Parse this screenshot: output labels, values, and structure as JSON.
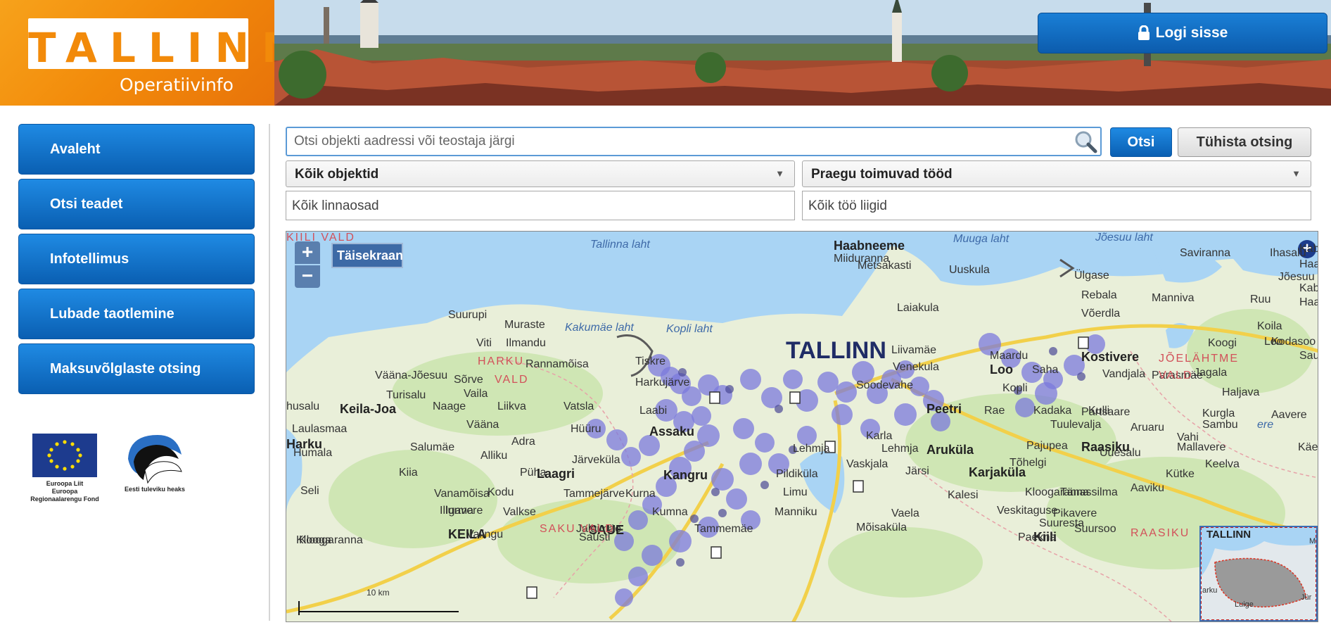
{
  "header": {
    "logo_word": "TALLINN",
    "logo_subtitle": "Operatiivinfo",
    "login_label": "Logi sisse",
    "login_icon": "lock-icon"
  },
  "sidebar": {
    "items": [
      {
        "label": "Avaleht"
      },
      {
        "label": "Otsi teadet"
      },
      {
        "label": "Infotellimus"
      },
      {
        "label": "Lubade taotlemine"
      },
      {
        "label": "Maksuvõlglaste otsing"
      }
    ]
  },
  "logos": {
    "eu_caption": "Euroopa Liit\nEuroopa\nRegionaalarengu Fond",
    "est_caption": "Eesti tuleviku heaks"
  },
  "search": {
    "placeholder": "Otsi objekti aadressi või teostaja järgi",
    "value": "",
    "submit_label": "Otsi",
    "clear_label": "Tühista otsing"
  },
  "filters": {
    "objects_selected": "Kõik objektid",
    "works_selected": "Praegu toimuvad tööd",
    "districts_placeholder": "Kõik linnaosad",
    "work_types_placeholder": "Kõik töö liigid"
  },
  "map": {
    "zoom_in": "+",
    "zoom_out": "−",
    "fullscreen_label": "Täisekraan",
    "scale_label": "10 km",
    "expand_icon": "+",
    "minimap_labels": {
      "city": "TALLINN",
      "a": "arku",
      "b": "Luige",
      "c": "Jür",
      "d": "M"
    },
    "labels": [
      {
        "text": "Tallinna laht",
        "kind": "water"
      },
      {
        "text": "Haabneeme",
        "kind": "town"
      },
      {
        "text": "Miiduranna",
        "kind": "plain"
      },
      {
        "text": "Muuga laht",
        "kind": "water"
      },
      {
        "text": "Jõesuu laht",
        "kind": "water"
      },
      {
        "text": "Saviranna",
        "kind": "plain"
      },
      {
        "text": "Ihasalu",
        "kind": "plain"
      },
      {
        "text": "Kaberneeme",
        "kind": "plain"
      },
      {
        "text": "Haapse",
        "kind": "plain"
      },
      {
        "text": "Metsakasti",
        "kind": "plain"
      },
      {
        "text": "Uuskula",
        "kind": "plain"
      },
      {
        "text": "Ülgase",
        "kind": "plain"
      },
      {
        "text": "Jõesuu",
        "kind": "plain"
      },
      {
        "text": "Kaberla",
        "kind": "plain"
      },
      {
        "text": "Haavakann",
        "kind": "plain"
      },
      {
        "text": "Rebala",
        "kind": "plain"
      },
      {
        "text": "Manniva",
        "kind": "plain"
      },
      {
        "text": "Ruu",
        "kind": "plain"
      },
      {
        "text": "Laiakula",
        "kind": "plain"
      },
      {
        "text": "Võerdla",
        "kind": "plain"
      },
      {
        "text": "Koila",
        "kind": "plain"
      },
      {
        "text": "Loo",
        "kind": "plain"
      },
      {
        "text": "Koogi",
        "kind": "plain"
      },
      {
        "text": "Kodasoo",
        "kind": "plain"
      },
      {
        "text": "Suurupi",
        "kind": "plain"
      },
      {
        "text": "Muraste",
        "kind": "plain"
      },
      {
        "text": "Kakumäe laht",
        "kind": "water"
      },
      {
        "text": "Kopli laht",
        "kind": "water"
      },
      {
        "text": "TALLINN",
        "kind": "city"
      },
      {
        "text": "Liivamäe",
        "kind": "plain"
      },
      {
        "text": "Maardu",
        "kind": "plain"
      },
      {
        "text": "Kostivere",
        "kind": "town"
      },
      {
        "text": "JÕELÄHTME",
        "kind": "region"
      },
      {
        "text": "Saun",
        "kind": "plain"
      },
      {
        "text": "Viti",
        "kind": "plain"
      },
      {
        "text": "Ilmandu",
        "kind": "plain"
      },
      {
        "text": "HARKU",
        "kind": "region"
      },
      {
        "text": "Rannamõisa",
        "kind": "plain"
      },
      {
        "text": "Tiskre",
        "kind": "plain"
      },
      {
        "text": "Venekula",
        "kind": "plain"
      },
      {
        "text": "Loo",
        "kind": "town"
      },
      {
        "text": "Saha",
        "kind": "plain"
      },
      {
        "text": "Vandjala",
        "kind": "plain"
      },
      {
        "text": "Parasmäe",
        "kind": "plain"
      },
      {
        "text": "VALD",
        "kind": "region"
      },
      {
        "text": "Jagala",
        "kind": "plain"
      },
      {
        "text": "Vääna-Jõesuu",
        "kind": "plain"
      },
      {
        "text": "VALD",
        "kind": "region"
      },
      {
        "text": "Sõrve",
        "kind": "plain"
      },
      {
        "text": "Harkujärve",
        "kind": "plain"
      },
      {
        "text": "Soodevahe",
        "kind": "plain"
      },
      {
        "text": "Kopli",
        "kind": "plain"
      },
      {
        "text": "Haljava",
        "kind": "plain"
      },
      {
        "text": "Turisalu",
        "kind": "plain"
      },
      {
        "text": "Vaila",
        "kind": "plain"
      },
      {
        "text": "husalu",
        "kind": "plain"
      },
      {
        "text": "Keila-Joa",
        "kind": "town"
      },
      {
        "text": "Naage",
        "kind": "plain"
      },
      {
        "text": "Liikva",
        "kind": "plain"
      },
      {
        "text": "Vatsla",
        "kind": "plain"
      },
      {
        "text": "Laabi",
        "kind": "plain"
      },
      {
        "text": "Peetri",
        "kind": "town"
      },
      {
        "text": "Rae",
        "kind": "plain"
      },
      {
        "text": "Kadaka",
        "kind": "plain"
      },
      {
        "text": "Kulli",
        "kind": "plain"
      },
      {
        "text": "Partsaare",
        "kind": "plain"
      },
      {
        "text": "Kurgla",
        "kind": "plain"
      },
      {
        "text": "Aavere",
        "kind": "plain"
      },
      {
        "text": "Laulasmaa",
        "kind": "plain"
      },
      {
        "text": "Vääna",
        "kind": "plain"
      },
      {
        "text": "Hüüru",
        "kind": "plain"
      },
      {
        "text": "Tuulevalja",
        "kind": "plain"
      },
      {
        "text": "Aruaru",
        "kind": "plain"
      },
      {
        "text": "Sambu",
        "kind": "plain"
      },
      {
        "text": "ere",
        "kind": "water"
      },
      {
        "text": "Harku",
        "kind": "town"
      },
      {
        "text": "Assaku",
        "kind": "town"
      },
      {
        "text": "Karla",
        "kind": "plain"
      },
      {
        "text": "Pajupea",
        "kind": "plain"
      },
      {
        "text": "Raasiku",
        "kind": "town"
      },
      {
        "text": "Vahi",
        "kind": "plain"
      },
      {
        "text": "Adra",
        "kind": "plain"
      },
      {
        "text": "Salumäe",
        "kind": "plain"
      },
      {
        "text": "Mallavere",
        "kind": "plain"
      },
      {
        "text": "Käesalu",
        "kind": "plain"
      },
      {
        "text": "Humala",
        "kind": "plain"
      },
      {
        "text": "Alliku",
        "kind": "plain"
      },
      {
        "text": "Järveküla",
        "kind": "plain"
      },
      {
        "text": "Lehmja",
        "kind": "plain"
      },
      {
        "text": "Lehmja",
        "kind": "plain"
      },
      {
        "text": "Aruküla",
        "kind": "town"
      },
      {
        "text": "Uuesalu",
        "kind": "plain"
      },
      {
        "text": "Vaskjala",
        "kind": "plain"
      },
      {
        "text": "Tõhelgi",
        "kind": "plain"
      },
      {
        "text": "Keelva",
        "kind": "plain"
      },
      {
        "text": "Kiia",
        "kind": "plain"
      },
      {
        "text": "Püha",
        "kind": "plain"
      },
      {
        "text": "Laagri",
        "kind": "town"
      },
      {
        "text": "Kangru",
        "kind": "town"
      },
      {
        "text": "Pildiküla",
        "kind": "plain"
      },
      {
        "text": "Järsi",
        "kind": "plain"
      },
      {
        "text": "Karjaküla",
        "kind": "town"
      },
      {
        "text": "Kütke",
        "kind": "plain"
      },
      {
        "text": "Vanamõisa",
        "kind": "plain"
      },
      {
        "text": "Kodu",
        "kind": "plain"
      },
      {
        "text": "Tammejärve",
        "kind": "plain"
      },
      {
        "text": "Kurna",
        "kind": "plain"
      },
      {
        "text": "Limu",
        "kind": "plain"
      },
      {
        "text": "Kalesi",
        "kind": "plain"
      },
      {
        "text": "Kloogaranna",
        "kind": "plain"
      },
      {
        "text": "Tänassilma",
        "kind": "plain"
      },
      {
        "text": "Aaviku",
        "kind": "plain"
      },
      {
        "text": "Seli",
        "kind": "plain"
      },
      {
        "text": "Igavere",
        "kind": "plain"
      },
      {
        "text": "Illurma",
        "kind": "plain"
      },
      {
        "text": "Valkse",
        "kind": "plain"
      },
      {
        "text": "Kumna",
        "kind": "plain"
      },
      {
        "text": "Manniku",
        "kind": "plain"
      },
      {
        "text": "Vaela",
        "kind": "plain"
      },
      {
        "text": "Veskitaguse",
        "kind": "plain"
      },
      {
        "text": "Pikavere",
        "kind": "plain"
      },
      {
        "text": "SAUE",
        "kind": "town"
      },
      {
        "text": "Jalgimäe",
        "kind": "plain"
      },
      {
        "text": "Tammemäe",
        "kind": "plain"
      },
      {
        "text": "Mõisaküla",
        "kind": "plain"
      },
      {
        "text": "Kloogaranna",
        "kind": "plain"
      },
      {
        "text": "Klooga",
        "kind": "plain"
      },
      {
        "text": "KEILA",
        "kind": "town"
      },
      {
        "text": "Valingu",
        "kind": "plain"
      },
      {
        "text": "SAKU VALD",
        "kind": "region"
      },
      {
        "text": "Saustl",
        "kind": "plain"
      },
      {
        "text": "Kiili",
        "kind": "town"
      },
      {
        "text": "Paekna",
        "kind": "plain"
      },
      {
        "text": "Suuresta",
        "kind": "plain"
      },
      {
        "text": "Suursoo",
        "kind": "plain"
      },
      {
        "text": "RAASIKU",
        "kind": "region"
      },
      {
        "text": "KIILI VALD",
        "kind": "region"
      }
    ]
  }
}
